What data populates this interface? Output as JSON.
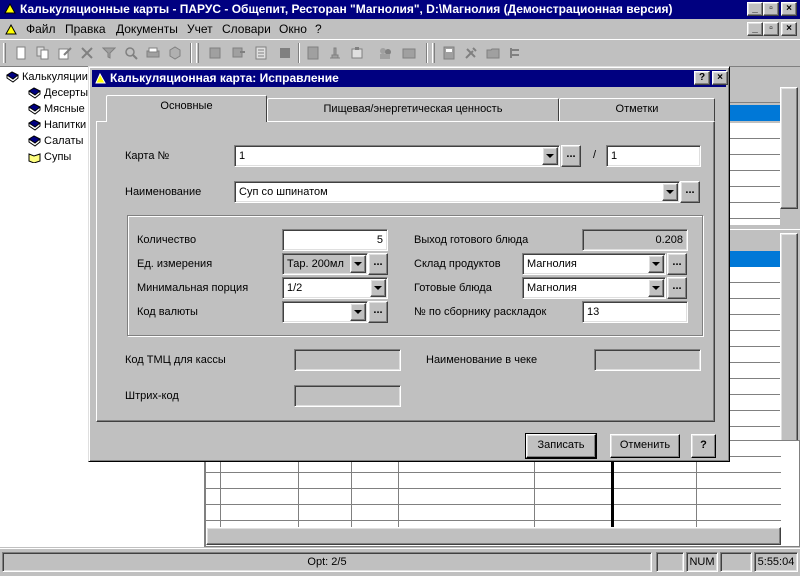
{
  "app": {
    "title": "Калькуляционные карты - ПАРУС - Общепит, Ресторан \"Магнолия\", D:\\Магнолия (Демонстрационная версия)",
    "min_btn": "_",
    "max_btn": "▫",
    "close_btn": "×"
  },
  "mdi_controls": {
    "min": "_",
    "restore": "▫",
    "close": "×"
  },
  "menu": {
    "items": [
      {
        "label": "Файл"
      },
      {
        "label": "Правка"
      },
      {
        "label": "Документы"
      },
      {
        "label": "Учет"
      },
      {
        "label": "Словари"
      },
      {
        "label": "Окно"
      },
      {
        "label": "?"
      }
    ]
  },
  "toolbar": {
    "buttons": [
      "new-icon",
      "copy-icon",
      "edit-icon",
      "delete-icon",
      "filter-icon",
      "search-icon",
      "print-icon",
      "refresh-icon",
      "doc-icon",
      "move-icon",
      "list-icon",
      "book-icon",
      "journal-icon",
      "stamp-icon",
      "archive-icon",
      "people-icon",
      "card-icon",
      "calculator-icon",
      "tools-icon",
      "folder-icon",
      "tree-icon"
    ]
  },
  "tree": {
    "root": "Калькуляции",
    "items": [
      "Десерты",
      "Мясные",
      "Напитки",
      "Салаты",
      "Супы"
    ]
  },
  "dialog": {
    "title": "Калькуляционная карта: Исправление",
    "help_btn": "?",
    "close_btn": "×",
    "tabs": [
      "Основные",
      "Пищевая/энергетическая ценность",
      "Отметки"
    ],
    "card_no_label": "Карта №",
    "card_no_value": "1",
    "card_no_sep": "/",
    "card_no_suffix": "1",
    "name_label": "Наименование",
    "name_value": "Суп со шпинатом",
    "qty_label": "Количество",
    "qty_value": "5",
    "unit_label": "Ед. измерения",
    "unit_value": "Тар. 200мл",
    "min_portion_label": "Минимальная порция",
    "min_portion_value": "1/2",
    "currency_label": "Код валюты",
    "currency_value": "",
    "yield_label": "Выход готового блюда",
    "yield_value": "0.208",
    "products_store_label": "Склад продуктов",
    "products_store_value": "Магнолия",
    "dishes_store_label": "Готовые блюда",
    "dishes_store_value": "Магнолия",
    "collection_no_label": "№ по сборнику раскладок",
    "collection_no_value": "13",
    "tmc_label": "Код ТМЦ для кассы",
    "tmc_value": "",
    "receipt_name_label": "Наименование в чеке",
    "receipt_name_value": "",
    "barcode_label": "Штрих-код",
    "barcode_value": "",
    "dots": "...",
    "save_btn": "Записать",
    "cancel_btn": "Отменить",
    "help2_btn": "?"
  },
  "status": {
    "record": "Opt: 2/5",
    "num": "NUM",
    "time": "5:55:04"
  }
}
